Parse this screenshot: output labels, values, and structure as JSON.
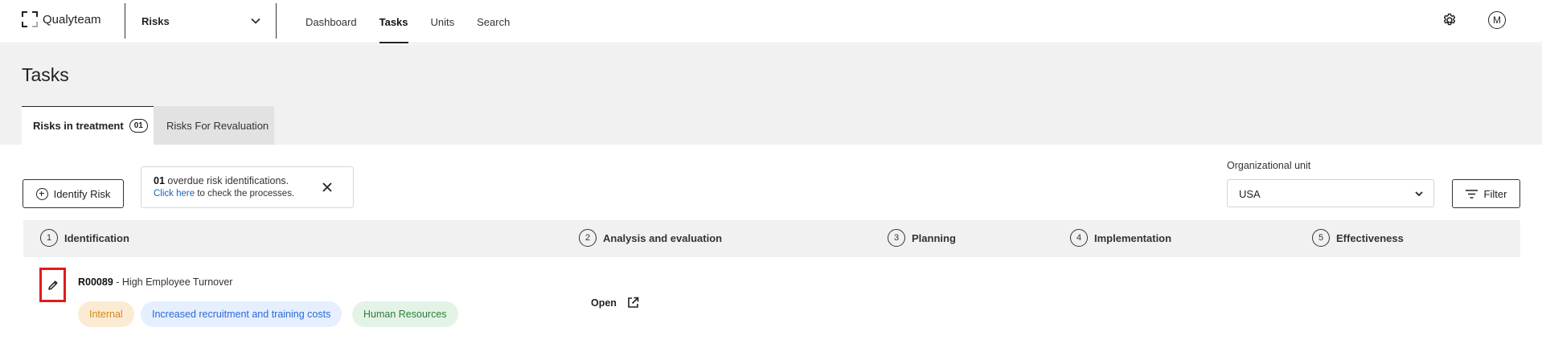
{
  "app": {
    "logo_text": "Qualyteam"
  },
  "module_select": {
    "value": "Risks"
  },
  "nav": {
    "items": [
      "Dashboard",
      "Tasks",
      "Units",
      "Search"
    ],
    "active": "Tasks"
  },
  "user": {
    "avatar_initial": "M"
  },
  "page": {
    "title": "Tasks"
  },
  "tabs": [
    {
      "label": "Risks in treatment",
      "count": "01",
      "active": true
    },
    {
      "label": "Risks For Revaluation",
      "active": false
    }
  ],
  "actions": {
    "identify_label": "Identify Risk",
    "filter_label": "Filter"
  },
  "notice": {
    "count": "01",
    "text": " overdue risk identifications.",
    "link_text": "Click here",
    "link_suffix": " to check the processes."
  },
  "org_unit": {
    "label": "Organizational unit",
    "value": "USA"
  },
  "steps": [
    {
      "num": "1",
      "label": "Identification"
    },
    {
      "num": "2",
      "label": "Analysis and evaluation"
    },
    {
      "num": "3",
      "label": "Planning"
    },
    {
      "num": "4",
      "label": "Implementation"
    },
    {
      "num": "5",
      "label": "Effectiveness"
    }
  ],
  "rows": [
    {
      "code": "R00089",
      "title": " - High Employee Turnover",
      "tags": [
        "Internal",
        "Increased recruitment and training costs",
        "Human Resources"
      ],
      "status": "Open"
    }
  ],
  "colors": {
    "highlight_border": "#e01c1c",
    "tag_internal_bg": "#fcebd3",
    "tag_costs_bg": "#e5efff",
    "tag_hr_bg": "#e3f3e6",
    "link": "#1565c0"
  }
}
